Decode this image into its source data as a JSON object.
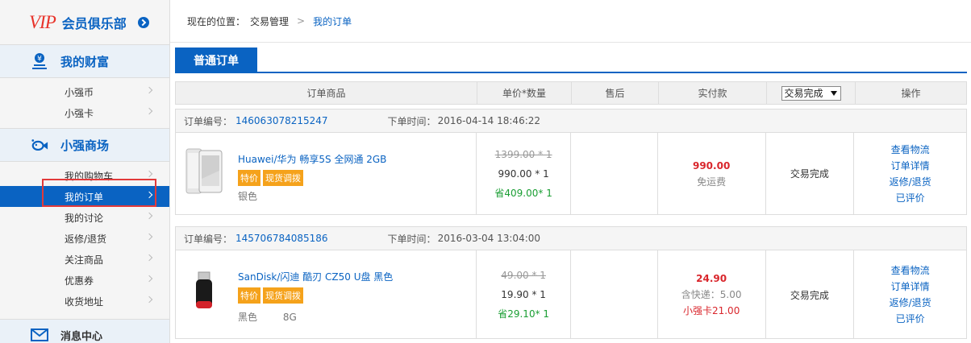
{
  "sidebar": {
    "vip_logo": "VIP",
    "vip_title": "会员俱乐部",
    "sections": {
      "wealth": {
        "title": "我的财富",
        "items": [
          "小强币",
          "小强卡"
        ]
      },
      "mall": {
        "title": "小强商场",
        "items": [
          "我的购物车",
          "我的订单",
          "我的讨论",
          "返修/退货",
          "关注商品",
          "优惠券",
          "收货地址"
        ]
      },
      "message": {
        "title": "消息中心"
      }
    },
    "active_item": "我的订单"
  },
  "breadcrumb": {
    "prefix": "现在的位置：",
    "level1": "交易管理",
    "sep": ">",
    "current": "我的订单"
  },
  "tab": {
    "label": "普通订单"
  },
  "table": {
    "headers": [
      "订单商品",
      "单价*数量",
      "售后",
      "实付款",
      "操作"
    ],
    "status_filter": "交易完成"
  },
  "orders": [
    {
      "no_label": "订单编号：",
      "no": "146063078215247",
      "time_label": "下单时间：",
      "time": "2016-04-14 18:46:22",
      "product": "Huawei/华为 畅享5S 全网通 2GB",
      "tags": [
        "特价",
        "现货调拨"
      ],
      "attr": [
        "银色"
      ],
      "old_price": "1399.00 * 1",
      "price": "990.00 * 1",
      "save": "409.00* 1",
      "save_prefix": "省",
      "pay": "990.00",
      "pay_note": "免运费",
      "pay_card": "",
      "status": "交易完成",
      "ops": [
        "查看物流",
        "订单详情",
        "返修/退货",
        "已评价"
      ]
    },
    {
      "no_label": "订单编号：",
      "no": "145706784085186",
      "time_label": "下单时间：",
      "time": "2016-03-04 13:04:00",
      "product": "SanDisk/闪迪 酷刃 CZ50 U盘 黑色",
      "tags": [
        "特价",
        "现货调拨"
      ],
      "attr": [
        "黑色",
        "8G"
      ],
      "old_price": "49.00 * 1",
      "price": "19.90 * 1",
      "save": "29.10* 1",
      "save_prefix": "省",
      "pay": "24.90",
      "pay_note": "含快递：5.00",
      "pay_card": "小强卡21.00",
      "status": "交易完成",
      "ops": [
        "查看物流",
        "订单详情",
        "返修/退货",
        "已评价"
      ]
    }
  ]
}
